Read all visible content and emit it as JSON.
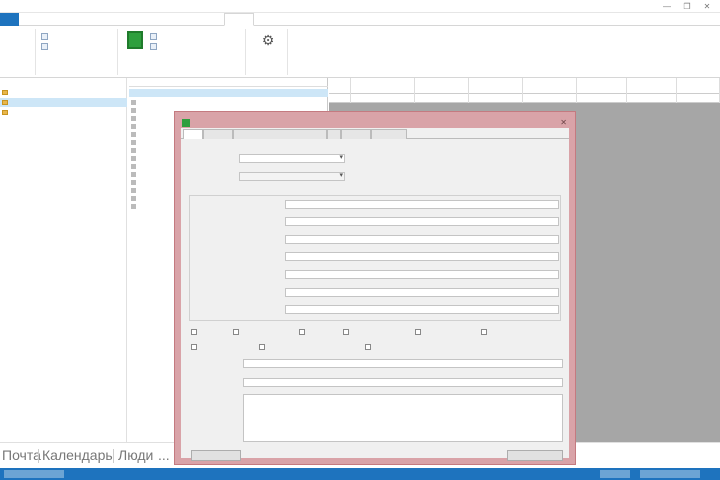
{
  "window": {
    "title": "",
    "controls": {
      "minimize": "—",
      "restore": "❐",
      "close": "✕"
    }
  },
  "ribbon": {
    "tabs": [
      {
        "label": ""
      },
      {
        "label": ""
      },
      {
        "label": ""
      },
      {
        "label": ""
      },
      {
        "label": ""
      },
      {
        "label": ""
      }
    ],
    "groups": [
      {
        "label": "",
        "items": [
          "",
          ""
        ]
      },
      {
        "label": "",
        "items": [
          "",
          ""
        ]
      },
      {
        "label": "",
        "big_button": "",
        "items": [
          "",
          ""
        ]
      },
      {
        "label": "",
        "big_button": ""
      }
    ]
  },
  "folders": [
    {
      "label": "",
      "selected": false
    },
    {
      "label": "",
      "selected": true
    },
    {
      "label": "",
      "selected": false
    }
  ],
  "list": {
    "header": "",
    "rows": [
      {
        "text": "",
        "selected": true
      },
      {
        "text": "",
        "selected": false
      },
      {
        "text": "",
        "selected": false
      },
      {
        "text": "",
        "selected": false
      },
      {
        "text": "",
        "selected": false
      },
      {
        "text": "",
        "selected": false
      },
      {
        "text": "",
        "selected": false
      },
      {
        "text": "",
        "selected": false
      },
      {
        "text": "",
        "selected": false
      },
      {
        "text": "",
        "selected": false
      },
      {
        "text": "",
        "selected": false
      },
      {
        "text": "",
        "selected": false
      },
      {
        "text": "",
        "selected": false
      },
      {
        "text": "",
        "selected": false
      },
      {
        "text": "",
        "selected": false
      }
    ]
  },
  "grid": {
    "columns": [
      "",
      "",
      "",
      "",
      "",
      "",
      "",
      ""
    ],
    "rows": [
      [
        "",
        "",
        "",
        "",
        "",
        "",
        "",
        ""
      ]
    ]
  },
  "dialog": {
    "title": "",
    "close": "✕",
    "tabs": [
      "",
      "",
      "",
      "",
      "",
      ""
    ],
    "fields_top": [
      {
        "label": "",
        "value": ""
      },
      {
        "label": "",
        "value": ""
      }
    ],
    "spin": "",
    "group_title": "",
    "group_fields": [
      {
        "label": "",
        "value": ""
      },
      {
        "label": "",
        "value": ""
      },
      {
        "label": "",
        "value": ""
      },
      {
        "label": "",
        "value": ""
      },
      {
        "label": "",
        "value": ""
      },
      {
        "label": "",
        "value": ""
      },
      {
        "label": "",
        "value": ""
      }
    ],
    "checkboxes_row1": [
      "",
      "",
      "",
      "",
      "",
      ""
    ],
    "checkboxes_row2": [
      "",
      "",
      ""
    ],
    "fields_bottom": [
      {
        "label": "",
        "value": ""
      },
      {
        "label": "",
        "value": ""
      }
    ],
    "notes_label": "",
    "notes_value": "",
    "buttons": {
      "left": "",
      "right": ""
    }
  },
  "navbar": {
    "items": [
      "Почта",
      "Календарь",
      "Люди",
      "..."
    ]
  },
  "colors": {
    "accent": "#1e73be",
    "dialog_frame": "#d9a3a8",
    "selection": "#cde6f7"
  }
}
